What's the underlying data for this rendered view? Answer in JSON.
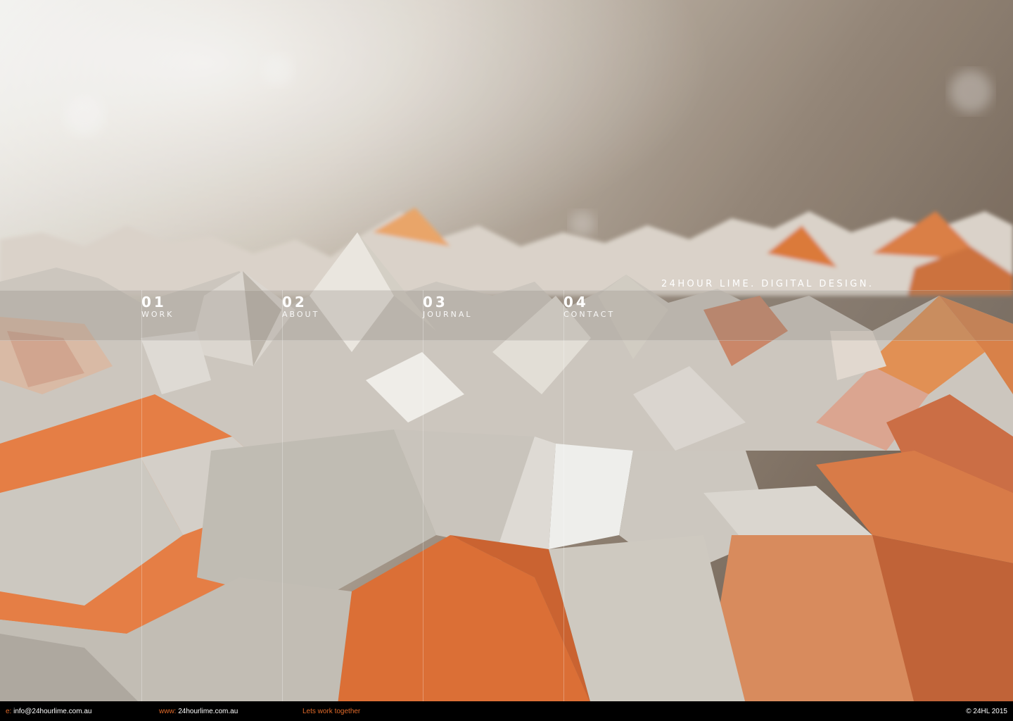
{
  "nav": [
    {
      "number": "01",
      "label": "WORK"
    },
    {
      "number": "02",
      "label": "ABOUT"
    },
    {
      "number": "03",
      "label": "JOURNAL"
    },
    {
      "number": "04",
      "label": "CONTACT"
    }
  ],
  "tagline": "24HOUR LIME. DIGITAL DESIGN.",
  "footer": {
    "email_prefix": "e:",
    "email": "info@24hourlime.com.au",
    "web_prefix": "www:",
    "web": "24hourlime.com.au",
    "cta": "Lets work together",
    "copyright": "© 24HL 2015"
  },
  "colors": {
    "accent": "#e06a2a",
    "footer_bg": "#000000",
    "text": "#ffffff"
  }
}
